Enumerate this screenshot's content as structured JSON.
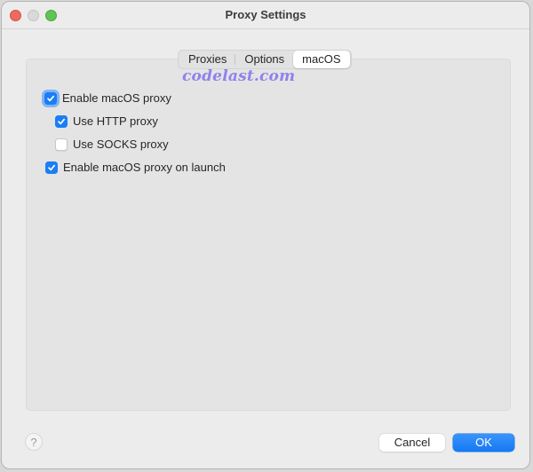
{
  "window": {
    "title": "Proxy Settings",
    "controls": [
      "close",
      "minimize",
      "zoom"
    ]
  },
  "tabs": [
    {
      "label": "Proxies",
      "active": false
    },
    {
      "label": "Options",
      "active": false
    },
    {
      "label": "macOS",
      "active": true
    }
  ],
  "watermark": "codelast.com",
  "options": [
    {
      "label": "Enable macOS proxy",
      "checked": true,
      "focused": true,
      "indent": 0
    },
    {
      "label": "Use HTTP proxy",
      "checked": true,
      "focused": false,
      "indent": 1
    },
    {
      "label": "Use SOCKS proxy",
      "checked": false,
      "focused": false,
      "indent": 1
    },
    {
      "label": "Enable macOS proxy on launch",
      "checked": true,
      "focused": false,
      "indent": 0
    }
  ],
  "footer": {
    "help_label": "?",
    "cancel_label": "Cancel",
    "ok_label": "OK"
  },
  "colors": {
    "accent": "#1a7ef5",
    "focus_ring": "#83b3f3",
    "watermark": "#8f82ea"
  }
}
